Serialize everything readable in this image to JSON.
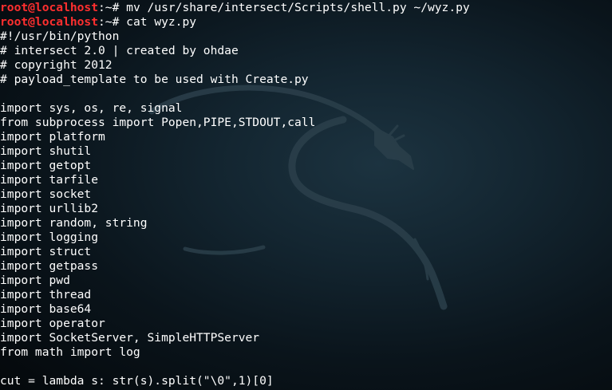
{
  "terminal": {
    "prompts": [
      {
        "user_host": "root@localhost",
        "rest": ":~# ",
        "command": "mv /usr/share/intersect/Scripts/shell.py ~/wyz.py"
      },
      {
        "user_host": "root@localhost",
        "rest": ":~# ",
        "command": "cat wyz.py"
      }
    ],
    "output_lines": [
      "#!/usr/bin/python",
      "# intersect 2.0 | created by ohdae",
      "# copyright 2012",
      "# payload_template to be used with Create.py",
      "",
      "import sys, os, re, signal",
      "from subprocess import Popen,PIPE,STDOUT,call",
      "import platform",
      "import shutil",
      "import getopt",
      "import tarfile",
      "import socket",
      "import urllib2",
      "import random, string",
      "import logging",
      "import struct",
      "import getpass",
      "import pwd",
      "import thread",
      "import base64",
      "import operator",
      "import SocketServer, SimpleHTTPServer",
      "from math import log",
      "",
      "cut = lambda s: str(s).split(\"\\0\",1)[0]"
    ]
  },
  "colors": {
    "prompt_user": "#ff2f2f",
    "text": "#ffffff",
    "background": "#0a141b",
    "watermark": "#2a3f4a"
  },
  "watermark": {
    "icon": "kali-dragon-icon"
  }
}
